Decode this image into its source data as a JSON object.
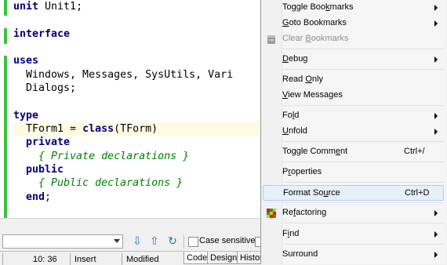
{
  "code": {
    "lines": [
      {
        "parts": [
          [
            "kw",
            "unit"
          ],
          [
            "id",
            " Unit1;"
          ]
        ]
      },
      {
        "parts": []
      },
      {
        "parts": [
          [
            "kw",
            "interface"
          ]
        ]
      },
      {
        "parts": []
      },
      {
        "parts": [
          [
            "kw",
            "uses"
          ]
        ]
      },
      {
        "parts": [
          [
            "id",
            "  Windows, Messages, SysUtils, Vari"
          ]
        ]
      },
      {
        "parts": [
          [
            "id",
            "  Dialogs;"
          ]
        ]
      },
      {
        "parts": []
      },
      {
        "parts": [
          [
            "kw",
            "type"
          ]
        ]
      },
      {
        "parts": [
          [
            "id",
            "  TForm1 = "
          ],
          [
            "kw",
            "class"
          ],
          [
            "id",
            "(TForm)"
          ]
        ]
      },
      {
        "parts": [
          [
            "kw",
            "  private"
          ]
        ]
      },
      {
        "parts": [
          [
            "cm",
            "    { Private declarations }"
          ]
        ]
      },
      {
        "parts": [
          [
            "kw",
            "  public"
          ]
        ]
      },
      {
        "parts": [
          [
            "cm",
            "    { Public declarations }"
          ]
        ]
      },
      {
        "parts": [
          [
            "kw",
            "  end"
          ],
          [
            "id",
            ";"
          ]
        ]
      }
    ]
  },
  "search": {
    "case_sensitive_label": "Case sensitive"
  },
  "status": {
    "position": "10: 36",
    "mode": "Insert",
    "modified": "Modified",
    "tabs": [
      "Code",
      "Design",
      "Histor"
    ]
  },
  "menu": {
    "items": [
      {
        "pre": "Toggle Boo",
        "acc": "k",
        "post": "marks",
        "shortcut": "",
        "submenu": true,
        "disabled": false,
        "icon": ""
      },
      {
        "pre": "",
        "acc": "G",
        "post": "oto Bookmarks",
        "shortcut": "",
        "submenu": true,
        "disabled": false,
        "icon": ""
      },
      {
        "pre": "Clear ",
        "acc": "B",
        "post": "ookmarks",
        "shortcut": "",
        "submenu": false,
        "disabled": true,
        "icon": "clear-bookmarks-icon"
      },
      {
        "pre": "",
        "acc": "D",
        "post": "ebug",
        "shortcut": "",
        "submenu": true,
        "disabled": false,
        "icon": ""
      },
      {
        "pre": "Read ",
        "acc": "O",
        "post": "nly",
        "shortcut": "",
        "submenu": false,
        "disabled": false,
        "icon": ""
      },
      {
        "pre": "",
        "acc": "V",
        "post": "iew Messages",
        "shortcut": "",
        "submenu": false,
        "disabled": false,
        "icon": ""
      },
      {
        "pre": "Fo",
        "acc": "l",
        "post": "d",
        "shortcut": "",
        "submenu": true,
        "disabled": false,
        "icon": ""
      },
      {
        "pre": "",
        "acc": "U",
        "post": "nfold",
        "shortcut": "",
        "submenu": true,
        "disabled": false,
        "icon": ""
      },
      {
        "pre": "Toggle Comm",
        "acc": "e",
        "post": "nt",
        "shortcut": "Ctrl+/",
        "submenu": false,
        "disabled": false,
        "icon": ""
      },
      {
        "pre": "P",
        "acc": "r",
        "post": "operties",
        "shortcut": "",
        "submenu": false,
        "disabled": false,
        "icon": ""
      },
      {
        "pre": "Format So",
        "acc": "u",
        "post": "rce",
        "shortcut": "Ctrl+D",
        "submenu": false,
        "disabled": false,
        "icon": "",
        "hover": true
      },
      {
        "pre": "Re",
        "acc": "f",
        "post": "actoring",
        "shortcut": "",
        "submenu": true,
        "disabled": false,
        "icon": "refactoring-cube-icon"
      },
      {
        "pre": "F",
        "acc": "i",
        "post": "nd",
        "shortcut": "",
        "submenu": true,
        "disabled": false,
        "icon": ""
      },
      {
        "pre": "Surround",
        "acc": "",
        "post": "",
        "shortcut": "",
        "submenu": true,
        "disabled": false,
        "icon": ""
      }
    ]
  },
  "colors": {
    "keyword": "#000080",
    "comment": "#008000",
    "gutter_change": "#3dc33d",
    "menu_hover_border": "#aecff7"
  }
}
